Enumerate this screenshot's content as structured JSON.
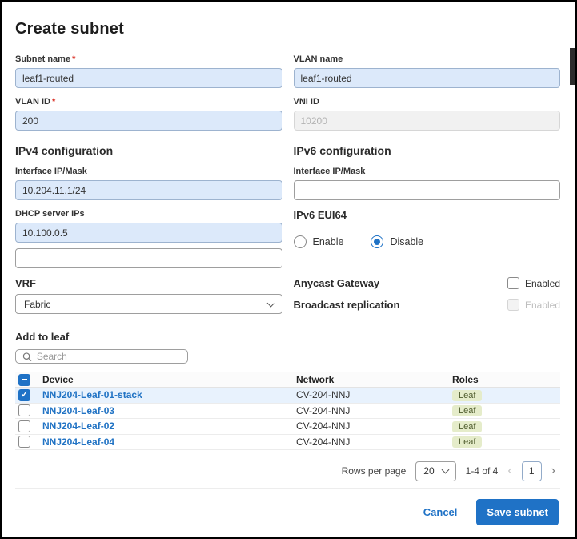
{
  "required_marker": "*",
  "dialog": {
    "title": "Create subnet"
  },
  "fields": {
    "subnet_name": {
      "label": "Subnet name",
      "value": "leaf1-routed"
    },
    "vlan_name": {
      "label": "VLAN name",
      "value": "leaf1-routed"
    },
    "vlan_id": {
      "label": "VLAN ID",
      "value": "200"
    },
    "vni_id": {
      "label": "VNI ID",
      "value": "10200"
    },
    "ipv4_section": "IPv4 configuration",
    "ipv6_section": "IPv6 configuration",
    "ipv4_interface": {
      "label": "Interface IP/Mask",
      "value": "10.204.11.1/24"
    },
    "ipv6_interface": {
      "label": "Interface IP/Mask",
      "value": ""
    },
    "dhcp": {
      "label": "DHCP server IPs",
      "value_1": "10.100.0.5",
      "value_2": ""
    },
    "eui64": {
      "label": "IPv6 EUI64",
      "enable": "Enable",
      "disable": "Disable"
    },
    "vrf": {
      "label": "VRF",
      "value": "Fabric"
    },
    "anycast": {
      "label": "Anycast Gateway",
      "checkbox": "Enabled"
    },
    "broadcast": {
      "label": "Broadcast replication",
      "checkbox": "Enabled"
    },
    "add_to_leaf": "Add to leaf"
  },
  "search": {
    "placeholder": "Search"
  },
  "table": {
    "headers": {
      "device": "Device",
      "network": "Network",
      "roles": "Roles"
    },
    "rows": [
      {
        "device": "NNJ204-Leaf-01-stack",
        "network": "CV-204-NNJ",
        "role": "Leaf"
      },
      {
        "device": "NNJ204-Leaf-03",
        "network": "CV-204-NNJ",
        "role": "Leaf"
      },
      {
        "device": "NNJ204-Leaf-02",
        "network": "CV-204-NNJ",
        "role": "Leaf"
      },
      {
        "device": "NNJ204-Leaf-04",
        "network": "CV-204-NNJ",
        "role": "Leaf"
      }
    ]
  },
  "pagination": {
    "rows_per_page_label": "Rows per page",
    "rows_per_page_value": "20",
    "range": "1-4 of 4",
    "page": "1",
    "prev": "‹",
    "next": "›"
  },
  "footer": {
    "cancel": "Cancel",
    "save": "Save subnet"
  },
  "colors": {
    "accent": "#1f72c6",
    "filled_input_bg": "#dce9fa",
    "selected_row_bg": "#e8f2fd",
    "badge_bg": "#e5ecca"
  }
}
